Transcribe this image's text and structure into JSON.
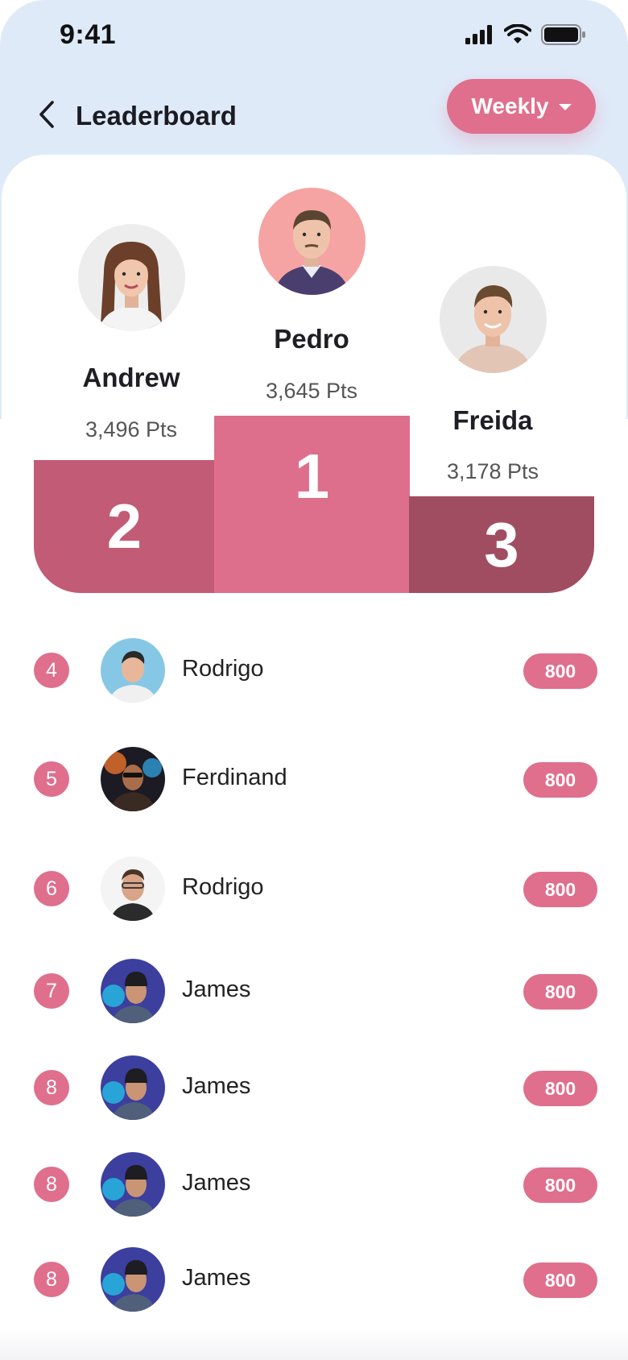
{
  "status": {
    "time": "9:41"
  },
  "header": {
    "title": "Leaderboard",
    "filter_label": "Weekly"
  },
  "podium": {
    "first": {
      "rank": "1",
      "name": "Pedro",
      "points": "3,645 Pts"
    },
    "second": {
      "rank": "2",
      "name": "Andrew",
      "points": "3,496 Pts"
    },
    "third": {
      "rank": "3",
      "name": "Freida",
      "points": "3,178 Pts"
    }
  },
  "list": [
    {
      "rank": "4",
      "name": "Rodrigo",
      "score": "800"
    },
    {
      "rank": "5",
      "name": "Ferdinand",
      "score": "800"
    },
    {
      "rank": "6",
      "name": "Rodrigo",
      "score": "800"
    },
    {
      "rank": "7",
      "name": "James",
      "score": "800"
    },
    {
      "rank": "8",
      "name": "James",
      "score": "800"
    },
    {
      "rank": "8",
      "name": "James",
      "score": "800"
    },
    {
      "rank": "8",
      "name": "James",
      "score": "800"
    }
  ],
  "colors": {
    "accent": "#df6f8d",
    "podium_second": "#c25b76",
    "podium_third": "#a14d61",
    "top_background": "#dfeaf9"
  }
}
